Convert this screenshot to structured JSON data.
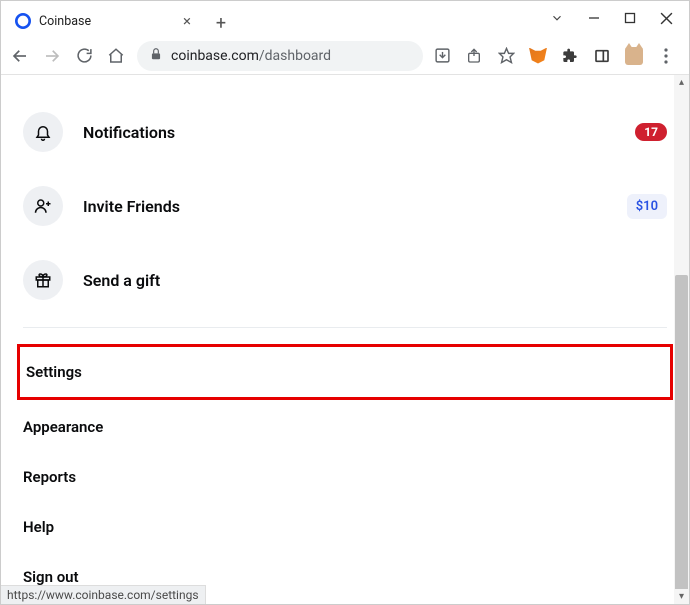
{
  "window": {
    "title": "Coinbase"
  },
  "browser": {
    "tab_title": "Coinbase",
    "url_host": "coinbase.com",
    "url_path": "/dashboard"
  },
  "menu": {
    "notifications": {
      "label": "Notifications",
      "badge": "17"
    },
    "invite": {
      "label": "Invite Friends",
      "badge": "$10"
    },
    "gift": {
      "label": "Send a gift"
    }
  },
  "list": {
    "settings": "Settings",
    "appearance": "Appearance",
    "reports": "Reports",
    "help": "Help",
    "signout": "Sign out"
  },
  "status_url": "https://www.coinbase.com/settings"
}
